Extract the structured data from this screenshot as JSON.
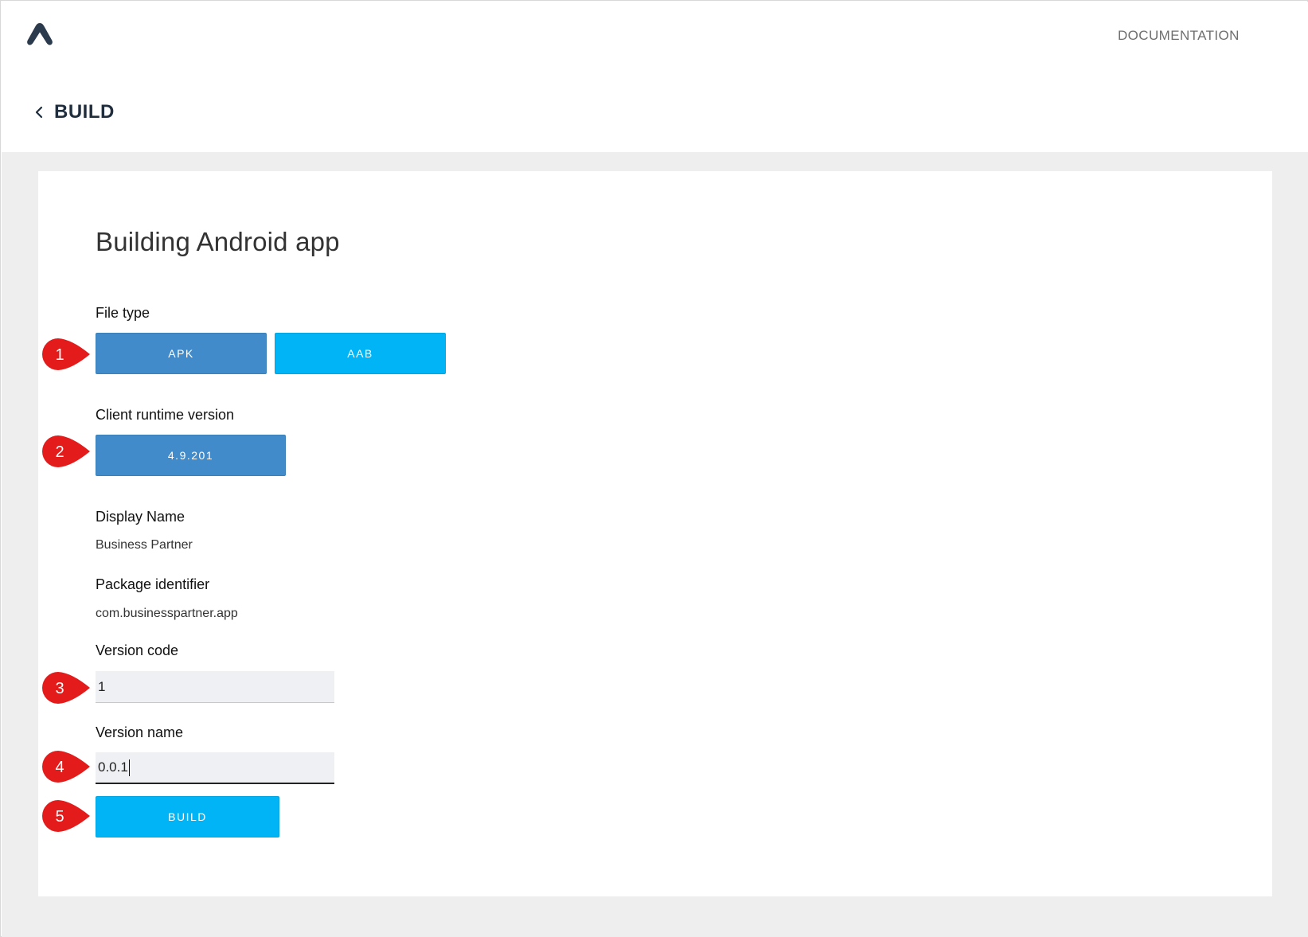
{
  "header": {
    "logo_icon": "triangle-a-logo-icon",
    "documentation_link": "DOCUMENTATION",
    "back_icon": "chevron-left-icon",
    "back_title": "BUILD"
  },
  "card": {
    "title": "Building Android app",
    "file_type": {
      "label": "File type",
      "options": [
        {
          "label": "APK",
          "selected": true
        },
        {
          "label": "AAB",
          "selected": false
        }
      ]
    },
    "client_runtime": {
      "label": "Client runtime version",
      "value": "4.9.201"
    },
    "display_name": {
      "label": "Display Name",
      "value": "Business Partner"
    },
    "package_identifier": {
      "label": "Package identifier",
      "value": "com.businesspartner.app"
    },
    "version_code": {
      "label": "Version code",
      "value": "1"
    },
    "version_name": {
      "label": "Version name",
      "value": "0.0.1"
    },
    "build_button": "BUILD"
  },
  "markers": [
    "1",
    "2",
    "3",
    "4",
    "5"
  ],
  "colors": {
    "selected_button": "#428bca",
    "primary_button": "#00b4f5",
    "marker_red": "#e31b1b",
    "content_background": "#eeeeee",
    "logo": "#2b3a4d"
  }
}
